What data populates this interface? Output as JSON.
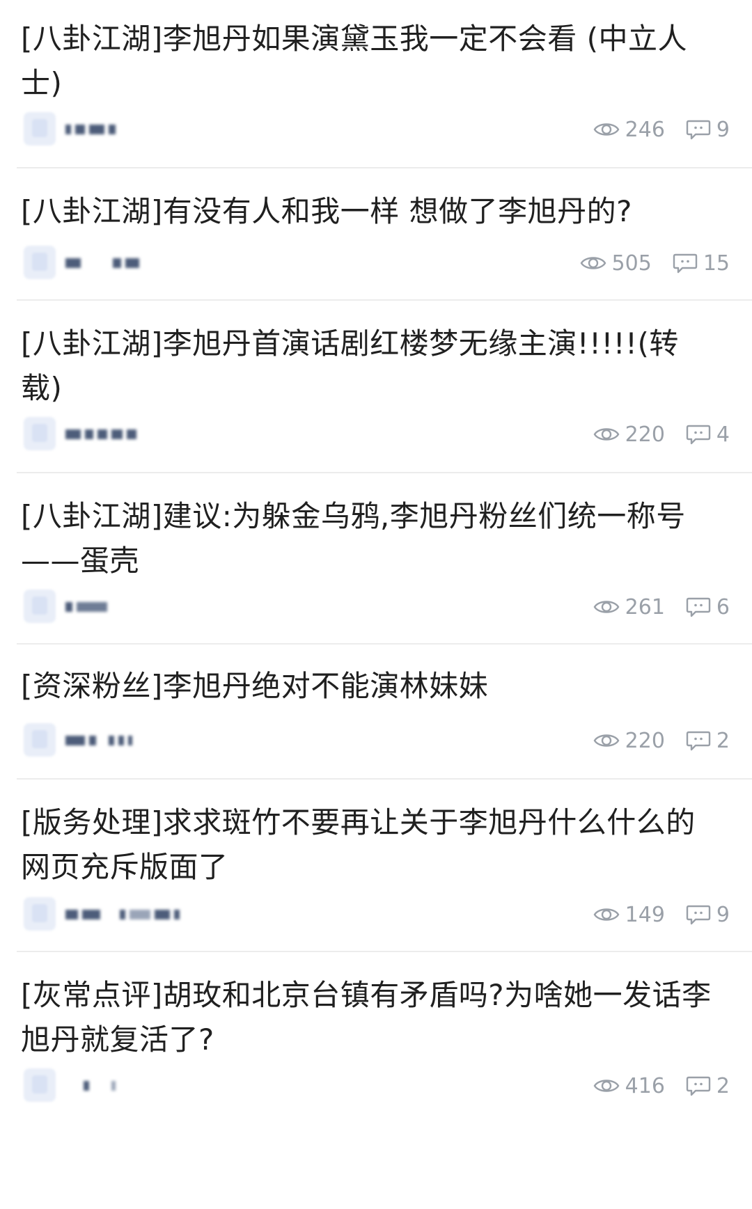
{
  "posts": [
    {
      "title": "[八卦江湖]李旭丹如果演黛玉我一定不会看 (中立人士)",
      "views": "246",
      "comments": "9"
    },
    {
      "title": "[八卦江湖]有没有人和我一样 想做了李旭丹的?",
      "views": "505",
      "comments": "15"
    },
    {
      "title": "[八卦江湖]李旭丹首演话剧红楼梦无缘主演!!!!!(转载)",
      "views": "220",
      "comments": "4"
    },
    {
      "title": "[八卦江湖]建议:为躲金乌鸦,李旭丹粉丝们统一称号——蛋壳",
      "views": "261",
      "comments": "6"
    },
    {
      "title": "[资深粉丝]李旭丹绝对不能演林妹妹",
      "views": "220",
      "comments": "2"
    },
    {
      "title": "[版务处理]求求斑竹不要再让关于李旭丹什么什么的网页充斥版面了",
      "views": "149",
      "comments": "9"
    },
    {
      "title": "[灰常点评]胡玫和北京台镇有矛盾吗?为啥她一发话李旭丹就复活了?",
      "views": "416",
      "comments": "2"
    }
  ],
  "icons": {
    "views": "eye-icon",
    "comments": "comment-bubble-icon"
  },
  "colors": {
    "title": "#202020",
    "stats": "#9aa0a8",
    "divider": "#ececec"
  }
}
